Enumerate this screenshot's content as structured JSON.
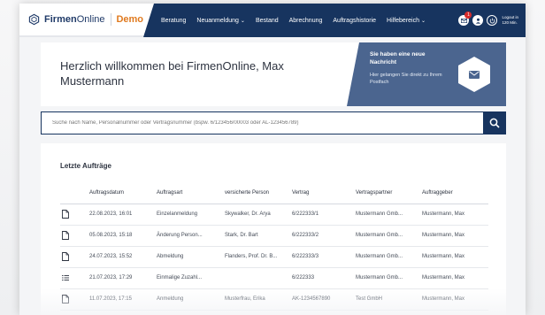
{
  "brand": {
    "name_light": "Firmen",
    "name_regular": "Online",
    "demo": "Demo"
  },
  "nav": {
    "items": [
      {
        "label": "Beratung",
        "dropdown": false
      },
      {
        "label": "Neuanmeldung",
        "dropdown": true
      },
      {
        "label": "Bestand",
        "dropdown": false
      },
      {
        "label": "Abrechnung",
        "dropdown": false
      },
      {
        "label": "Auftragshistorie",
        "dropdown": false
      },
      {
        "label": "Hilfebereich",
        "dropdown": true
      }
    ],
    "chevron": "⌄",
    "mail_badge": "1",
    "logout_line1": "Logout in",
    "logout_line2": "120 Min."
  },
  "welcome": {
    "text": "Herzlich willkommen bei FirmenOnline, Max Mustermann",
    "message_title": "Sie haben eine neue Nachricht",
    "message_sub": "Hier gelangen Sie direkt zu Ihrem Postfach"
  },
  "search": {
    "placeholder": "Suche nach Name, Personalnummer oder Vertragsnummer (bspw. 6/123456/00003 oder AL-123456789)"
  },
  "orders": {
    "title": "Letzte Aufträge",
    "columns": [
      "Auftragsdatum",
      "Auftragsart",
      "versicherte Person",
      "Vertrag",
      "Vertragspartner",
      "Auftraggeber"
    ],
    "rows": [
      {
        "icon": "document-icon",
        "date": "22.08.2023, 16:01",
        "type": "Einzelanmeldung",
        "person": "Skywalker, Dr. Arya",
        "contract": "6/222333/1",
        "partner": "Mustermann Gmb...",
        "client": "Mustermann, Max"
      },
      {
        "icon": "document-icon",
        "date": "05.08.2023, 15:18",
        "type": "Änderung Person...",
        "person": "Stark, Dr. Bart",
        "contract": "6/222333/2",
        "partner": "Mustermann Gmb...",
        "client": "Mustermann, Max"
      },
      {
        "icon": "document-icon",
        "date": "24.07.2023, 15:52",
        "type": "Abmeldung",
        "person": "Flanders, Prof. Dr. B...",
        "contract": "6/222333/3",
        "partner": "Mustermann Gmb...",
        "client": "Mustermann, Max"
      },
      {
        "icon": "list-icon",
        "date": "21.07.2023, 17:29",
        "type": "Einmalige Zuzahl...",
        "person": "",
        "contract": "6/222333",
        "partner": "Mustermann Gmb...",
        "client": "Mustermann, Max"
      },
      {
        "icon": "document-icon",
        "date": "11.07.2023, 17:15",
        "type": "Anmeldung",
        "person": "Musterfrau, Erika",
        "contract": "AK-1234567890",
        "partner": "Test GmbH",
        "client": "Mustermann, Max"
      }
    ]
  },
  "colors": {
    "navy": "#17345f",
    "accent_orange": "#e07a1f",
    "message_panel": "#4b658f",
    "badge_red": "#d62b2b"
  }
}
